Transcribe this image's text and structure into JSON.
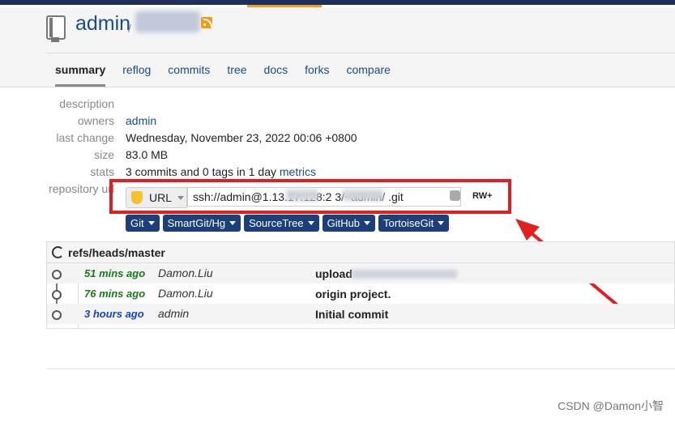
{
  "header": {
    "repo_name": "admin",
    "separator": "/"
  },
  "tabs": [
    {
      "label": "summary"
    },
    {
      "label": "reflog"
    },
    {
      "label": "commits"
    },
    {
      "label": "tree"
    },
    {
      "label": "docs"
    },
    {
      "label": "forks"
    },
    {
      "label": "compare"
    }
  ],
  "meta": {
    "description_label": "description",
    "owners_label": "owners",
    "owners_value": "admin",
    "last_change_label": "last change",
    "last_change_value": "Wednesday, November 23, 2022 00:06 +0800",
    "size_label": "size",
    "size_value": "83.0 MB",
    "stats_label": "stats",
    "stats_value": "3 commits and 0 tags in 1 day",
    "stats_link": "metrics",
    "repo_url_label": "repository url"
  },
  "repo_url": {
    "protocol": "URL",
    "value": "ssh://admin@1.13.17.128:2    3/~admin/        .git",
    "permission": "RW+"
  },
  "clients": [
    {
      "label": "Git"
    },
    {
      "label": "SmartGit/Hg"
    },
    {
      "label": "SourceTree"
    },
    {
      "label": "GitHub"
    },
    {
      "label": "TortoiseGit"
    }
  ],
  "branch": {
    "name": "refs/heads/master"
  },
  "commits": [
    {
      "age": "51 mins ago",
      "age_color": "#1a7a1a",
      "author": "Damon.Liu",
      "message": "upload"
    },
    {
      "age": "76 mins ago",
      "age_color": "#1a7a1a",
      "author": "Damon.Liu",
      "message": "origin project."
    },
    {
      "age": "3 hours ago",
      "age_color": "#1a3fcc",
      "author": "admin",
      "message": "Initial commit"
    }
  ],
  "watermark": "CSDN @Damon小智",
  "colors": {
    "highlight": "#e02020",
    "link": "#1a4b8c",
    "button": "#1c3f7a"
  }
}
